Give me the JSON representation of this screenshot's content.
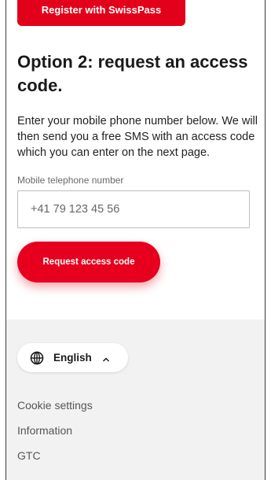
{
  "top_button": {
    "label": "Register with SwissPass"
  },
  "option2": {
    "heading": "Option 2: request an access code.",
    "description": "Enter your mobile phone number below. We will then send you a free SMS with an access code which you can enter on the next page.",
    "field_label": "Mobile telephone number",
    "phone_placeholder": "+41 79 123 45 56",
    "request_button": "Request access code"
  },
  "footer": {
    "language": {
      "label": "English",
      "icon": "globe-icon",
      "chevron": "chevron-up-icon"
    },
    "links": [
      "Cookie settings",
      "Information",
      "GTC"
    ]
  },
  "colors": {
    "primary_red": "#e2001a",
    "footer_bg": "#f2f2f2",
    "text": "#1a1a1a",
    "muted_text": "#6a6a6a"
  }
}
